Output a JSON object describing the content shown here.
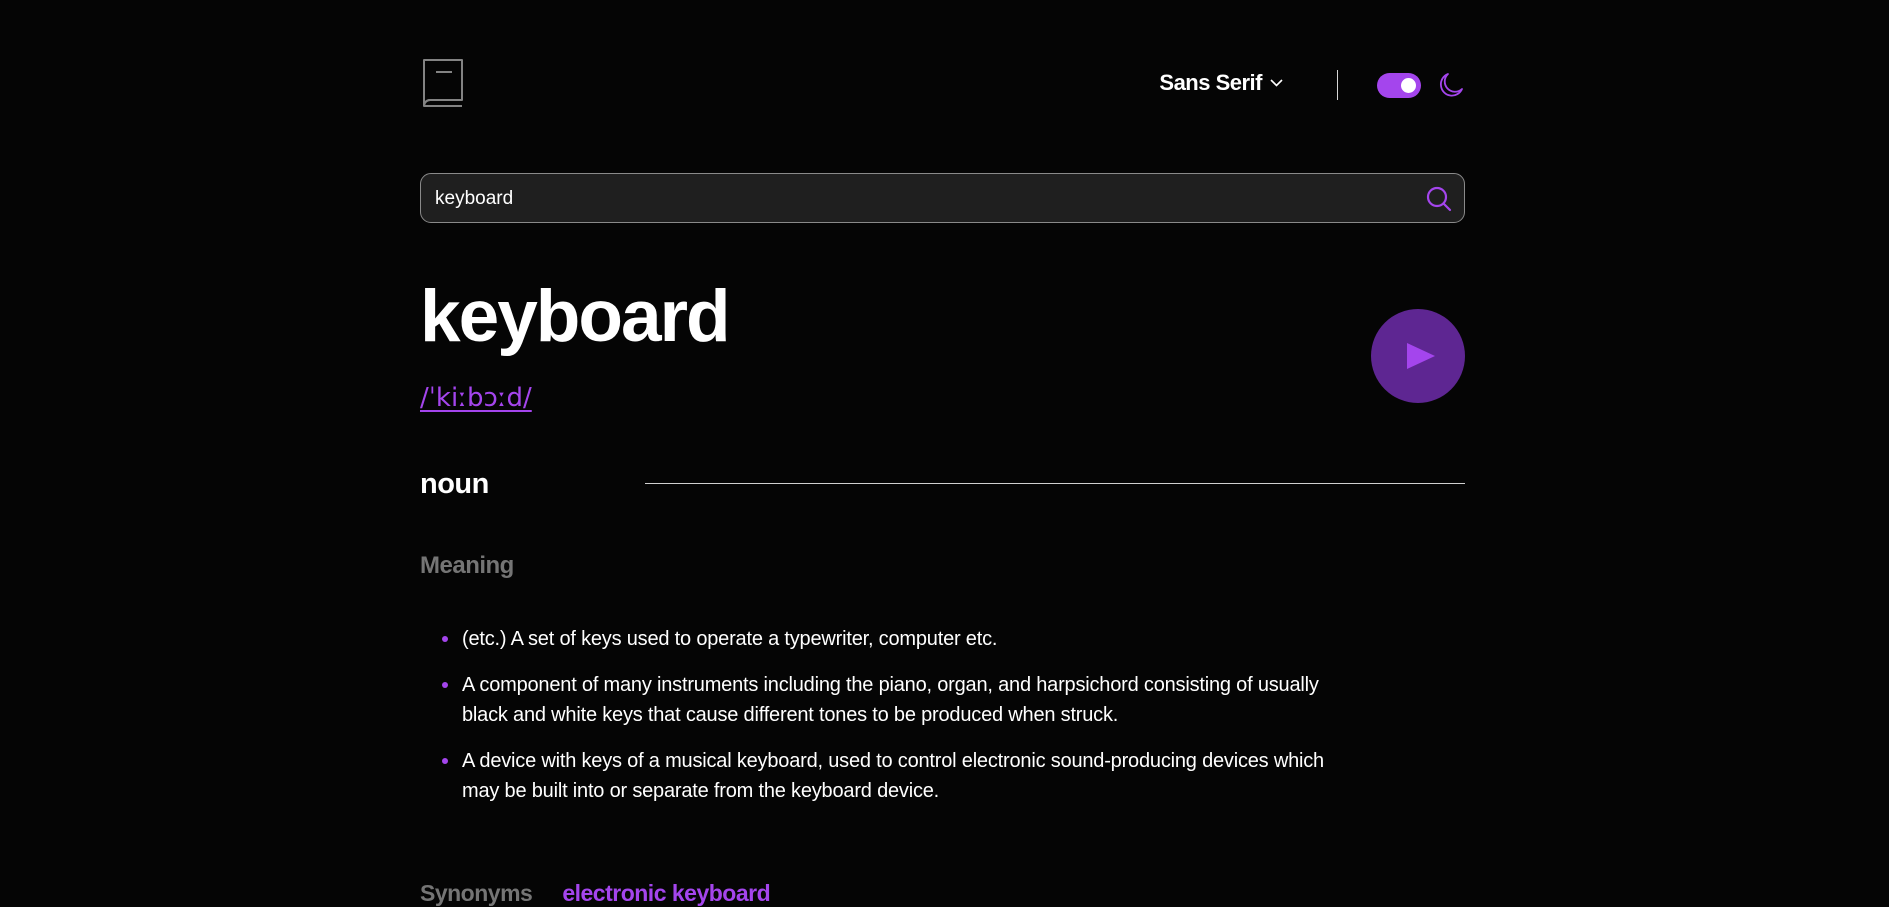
{
  "header": {
    "font_selector": "Sans Serif",
    "theme_toggle_state": "dark"
  },
  "search": {
    "value": "keyboard",
    "placeholder": ""
  },
  "entry": {
    "word": "keyboard",
    "phonetic": "/ˈkiːbɔːd/",
    "meanings": [
      {
        "part_of_speech": "noun",
        "heading": "Meaning",
        "definitions": [
          "(etc.) A set of keys used to operate a typewriter, computer etc.",
          "A component of many instruments including the piano, organ, and harpsichord consisting of usually black and white keys that cause different tones to be produced when struck.",
          "A device with keys of a musical keyboard, used to control electronic sound-producing devices which may be built into or separate from the keyboard device."
        ],
        "synonyms_label": "Synonyms",
        "synonyms": [
          "electronic keyboard"
        ]
      }
    ]
  },
  "colors": {
    "accent": "#a445ed",
    "play_button": "#5e2692",
    "background": "#050505",
    "muted_text": "#757575"
  },
  "icons": {
    "logo": "book-icon",
    "chevron": "chevron-down-icon",
    "theme": "moon-icon",
    "search": "search-icon",
    "play": "play-icon"
  }
}
